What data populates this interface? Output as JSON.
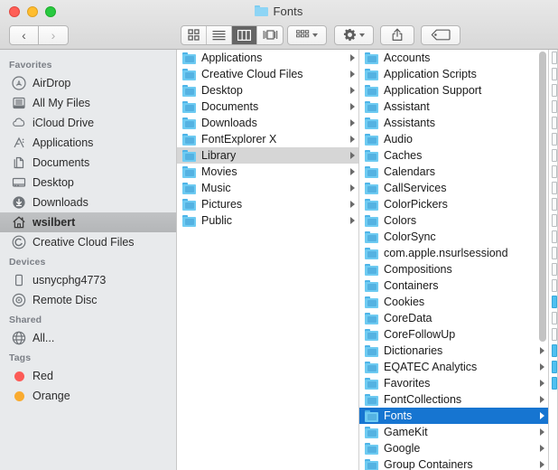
{
  "window": {
    "title": "Fonts",
    "title_icon": "folder-icon",
    "controls": [
      {
        "name": "close",
        "color": "#ff5f57"
      },
      {
        "name": "minimize",
        "color": "#ffbd2e"
      },
      {
        "name": "maximize",
        "color": "#28c940"
      }
    ]
  },
  "toolbar": {
    "back_label": "‹",
    "forward_label": "›",
    "view_modes": [
      {
        "name": "icon-view",
        "icon": "grid-icon",
        "active": false
      },
      {
        "name": "list-view",
        "icon": "list-icon",
        "active": false
      },
      {
        "name": "column-view",
        "icon": "columns-icon",
        "active": true
      },
      {
        "name": "coverflow-view",
        "icon": "coverflow-icon",
        "active": false
      }
    ],
    "arrange_icon": "arrange-icon",
    "action_icon": "gear-icon",
    "share_icon": "share-icon",
    "tag_icon": "tag-icon"
  },
  "sidebar": {
    "sections": [
      {
        "header": "Favorites",
        "items": [
          {
            "label": "AirDrop",
            "icon": "airdrop-icon",
            "selected": false
          },
          {
            "label": "All My Files",
            "icon": "all-my-files-icon",
            "selected": false
          },
          {
            "label": "iCloud Drive",
            "icon": "icloud-icon",
            "selected": false
          },
          {
            "label": "Applications",
            "icon": "applications-icon",
            "selected": false
          },
          {
            "label": "Documents",
            "icon": "documents-icon",
            "selected": false
          },
          {
            "label": "Desktop",
            "icon": "desktop-icon",
            "selected": false
          },
          {
            "label": "Downloads",
            "icon": "downloads-icon",
            "selected": false
          },
          {
            "label": "wsilbert",
            "icon": "home-icon",
            "selected": true
          },
          {
            "label": "Creative Cloud Files",
            "icon": "creative-cloud-icon",
            "selected": false
          }
        ]
      },
      {
        "header": "Devices",
        "items": [
          {
            "label": "usnycphg4773",
            "icon": "harddisk-icon",
            "selected": false
          },
          {
            "label": "Remote Disc",
            "icon": "disc-icon",
            "selected": false
          }
        ]
      },
      {
        "header": "Shared",
        "items": [
          {
            "label": "All...",
            "icon": "network-globe-icon",
            "selected": false
          }
        ]
      },
      {
        "header": "Tags",
        "items": [
          {
            "label": "Red",
            "icon": "tag-dot-icon",
            "color": "#fc5b57",
            "selected": false
          },
          {
            "label": "Orange",
            "icon": "tag-dot-icon",
            "color": "#f9ab30",
            "selected": false
          }
        ]
      }
    ]
  },
  "columns": [
    {
      "name": "column-home",
      "items": [
        {
          "label": "Applications",
          "icon": "folder-icon",
          "selected": false,
          "has_children": true
        },
        {
          "label": "Creative Cloud Files",
          "icon": "folder-icon",
          "selected": false,
          "has_children": true
        },
        {
          "label": "Desktop",
          "icon": "folder-icon",
          "selected": false,
          "has_children": true
        },
        {
          "label": "Documents",
          "icon": "folder-icon",
          "selected": false,
          "has_children": true
        },
        {
          "label": "Downloads",
          "icon": "folder-icon",
          "selected": false,
          "has_children": true
        },
        {
          "label": "FontExplorer X",
          "icon": "folder-icon",
          "selected": false,
          "has_children": true
        },
        {
          "label": "Library",
          "icon": "folder-icon",
          "selected": true,
          "has_children": true
        },
        {
          "label": "Movies",
          "icon": "folder-icon",
          "selected": false,
          "has_children": true
        },
        {
          "label": "Music",
          "icon": "folder-icon",
          "selected": false,
          "has_children": true
        },
        {
          "label": "Pictures",
          "icon": "folder-icon",
          "selected": false,
          "has_children": true
        },
        {
          "label": "Public",
          "icon": "folder-icon",
          "selected": false,
          "has_children": true
        }
      ]
    },
    {
      "name": "column-library",
      "items": [
        {
          "label": "Accounts",
          "icon": "folder-icon",
          "selected": false,
          "has_children": true
        },
        {
          "label": "Application Scripts",
          "icon": "folder-icon",
          "selected": false,
          "has_children": true
        },
        {
          "label": "Application Support",
          "icon": "folder-icon",
          "selected": false,
          "has_children": true
        },
        {
          "label": "Assistant",
          "icon": "folder-icon",
          "selected": false,
          "has_children": true
        },
        {
          "label": "Assistants",
          "icon": "folder-icon",
          "selected": false,
          "has_children": true
        },
        {
          "label": "Audio",
          "icon": "folder-icon",
          "selected": false,
          "has_children": true
        },
        {
          "label": "Caches",
          "icon": "folder-icon",
          "selected": false,
          "has_children": true
        },
        {
          "label": "Calendars",
          "icon": "folder-icon",
          "selected": false,
          "has_children": true
        },
        {
          "label": "CallServices",
          "icon": "folder-icon",
          "selected": false,
          "has_children": true
        },
        {
          "label": "ColorPickers",
          "icon": "folder-icon",
          "selected": false,
          "has_children": true
        },
        {
          "label": "Colors",
          "icon": "folder-icon",
          "selected": false,
          "has_children": true
        },
        {
          "label": "ColorSync",
          "icon": "folder-icon",
          "selected": false,
          "has_children": true
        },
        {
          "label": "com.apple.nsurlsessiond",
          "icon": "folder-icon",
          "selected": false,
          "has_children": true
        },
        {
          "label": "Compositions",
          "icon": "folder-icon",
          "selected": false,
          "has_children": true
        },
        {
          "label": "Containers",
          "icon": "folder-icon",
          "selected": false,
          "has_children": true
        },
        {
          "label": "Cookies",
          "icon": "folder-icon",
          "selected": false,
          "has_children": true
        },
        {
          "label": "CoreData",
          "icon": "folder-icon",
          "selected": false,
          "has_children": true
        },
        {
          "label": "CoreFollowUp",
          "icon": "folder-icon",
          "selected": false,
          "has_children": true
        },
        {
          "label": "Dictionaries",
          "icon": "folder-icon",
          "selected": false,
          "has_children": true
        },
        {
          "label": "EQATEC Analytics",
          "icon": "folder-icon",
          "selected": false,
          "has_children": true
        },
        {
          "label": "Favorites",
          "icon": "folder-icon",
          "selected": false,
          "has_children": true
        },
        {
          "label": "FontCollections",
          "icon": "folder-icon",
          "selected": false,
          "has_children": true
        },
        {
          "label": "Fonts",
          "icon": "folder-icon",
          "selected": true,
          "has_children": true
        },
        {
          "label": "GameKit",
          "icon": "folder-icon",
          "selected": false,
          "has_children": true
        },
        {
          "label": "Google",
          "icon": "folder-icon",
          "selected": false,
          "has_children": true
        },
        {
          "label": "Group Containers",
          "icon": "folder-icon",
          "selected": false,
          "has_children": true
        }
      ]
    }
  ],
  "column3_partial": {
    "name": "column-fonts",
    "items": [
      {
        "icon": "document-icon",
        "tint": "white"
      },
      {
        "icon": "document-icon",
        "tint": "white"
      },
      {
        "icon": "document-icon",
        "tint": "white"
      },
      {
        "icon": "document-icon",
        "tint": "white"
      },
      {
        "icon": "document-icon",
        "tint": "white"
      },
      {
        "icon": "document-icon",
        "tint": "white"
      },
      {
        "icon": "document-icon",
        "tint": "white"
      },
      {
        "icon": "document-icon",
        "tint": "white"
      },
      {
        "icon": "document-icon",
        "tint": "white"
      },
      {
        "icon": "document-icon",
        "tint": "white"
      },
      {
        "icon": "document-icon",
        "tint": "white"
      },
      {
        "icon": "document-icon",
        "tint": "white"
      },
      {
        "icon": "document-icon",
        "tint": "white"
      },
      {
        "icon": "document-icon",
        "tint": "white"
      },
      {
        "icon": "document-icon",
        "tint": "white"
      },
      {
        "icon": "document-icon",
        "tint": "blue"
      },
      {
        "icon": "document-icon",
        "tint": "white"
      },
      {
        "icon": "document-icon",
        "tint": "white"
      },
      {
        "icon": "document-icon",
        "tint": "blue"
      },
      {
        "icon": "document-icon",
        "tint": "blue"
      },
      {
        "icon": "document-icon",
        "tint": "blue"
      }
    ]
  },
  "scrollbar": {
    "column2_thumb_top_pct": 0,
    "column2_thumb_height_pct": 70
  },
  "colors": {
    "selection_blue": "#1675d1",
    "selection_gray": "#d6d6d6",
    "folder_blue": "#6ecbf2",
    "sidebar_bg": "#e8eaec"
  }
}
